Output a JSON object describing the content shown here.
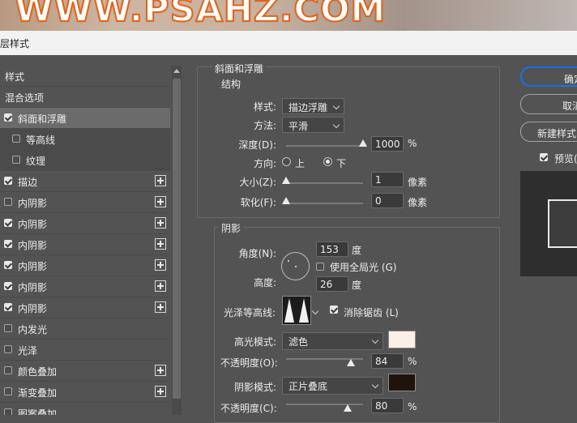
{
  "banner": {
    "text": "WWW.PSAHZ.COM"
  },
  "dialog": {
    "title": "层样式"
  },
  "left_list": [
    {
      "label": "样式",
      "checkbox": null,
      "plus": false,
      "state": "normal"
    },
    {
      "label": "混合选项",
      "checkbox": null,
      "plus": false,
      "state": "normal"
    },
    {
      "label": "斜面和浮雕",
      "checkbox": true,
      "plus": false,
      "state": "selected"
    },
    {
      "label": "等高线",
      "checkbox": false,
      "plus": false,
      "state": "sub"
    },
    {
      "label": "纹理",
      "checkbox": false,
      "plus": false,
      "state": "sub"
    },
    {
      "label": "描边",
      "checkbox": true,
      "plus": true,
      "state": "normal"
    },
    {
      "label": "内阴影",
      "checkbox": false,
      "plus": true,
      "state": "normal"
    },
    {
      "label": "内阴影",
      "checkbox": true,
      "plus": true,
      "state": "normal"
    },
    {
      "label": "内阴影",
      "checkbox": true,
      "plus": true,
      "state": "normal"
    },
    {
      "label": "内阴影",
      "checkbox": true,
      "plus": true,
      "state": "normal"
    },
    {
      "label": "内阴影",
      "checkbox": true,
      "plus": true,
      "state": "normal"
    },
    {
      "label": "内阴影",
      "checkbox": true,
      "plus": true,
      "state": "normal"
    },
    {
      "label": "内发光",
      "checkbox": false,
      "plus": false,
      "state": "normal"
    },
    {
      "label": "光泽",
      "checkbox": false,
      "plus": false,
      "state": "normal"
    },
    {
      "label": "颜色叠加",
      "checkbox": false,
      "plus": true,
      "state": "normal"
    },
    {
      "label": "渐变叠加",
      "checkbox": false,
      "plus": true,
      "state": "normal"
    },
    {
      "label": "图案叠加",
      "checkbox": false,
      "plus": false,
      "state": "normal"
    }
  ],
  "bevel": {
    "section_title": "斜面和浮雕",
    "structure_title": "结构",
    "style_label": "样式:",
    "style_value": "描边浮雕",
    "technique_label": "方法:",
    "technique_value": "平滑",
    "depth_label": "深度(D):",
    "depth_value": "1000",
    "depth_unit": "%",
    "depth_level": 1.0,
    "direction_label": "方向:",
    "dir_up": "上",
    "dir_down": "下",
    "dir_selected": "下",
    "size_label": "大小(Z):",
    "size_value": "1",
    "size_unit": "像素",
    "size_level": 0.0,
    "soften_label": "软化(F):",
    "soften_value": "0",
    "soften_unit": "像素",
    "soften_level": 0.0
  },
  "shading": {
    "title": "阴影",
    "angle_label": "角度(N):",
    "angle_value": "153",
    "angle_unit": "度",
    "global_light_label": "使用全局光 (G)",
    "global_light_checked": false,
    "altitude_label": "高度:",
    "altitude_value": "26",
    "altitude_unit": "度",
    "gloss_label": "光泽等高线:",
    "antialias_label": "消除锯齿 (L)",
    "antialias_checked": true,
    "highlight_mode_label": "高光模式:",
    "highlight_mode_value": "滤色",
    "highlight_color": "#fcf0e6",
    "highlight_opacity_label": "不透明度(O):",
    "highlight_opacity_value": "84",
    "highlight_opacity_unit": "%",
    "highlight_opacity_level": 0.84,
    "shadow_mode_label": "阴影模式:",
    "shadow_mode_value": "正片叠底",
    "shadow_color": "#1f140c",
    "shadow_opacity_label": "不透明度(C):",
    "shadow_opacity_value": "80",
    "shadow_opacity_unit": "%",
    "shadow_opacity_level": 0.8
  },
  "right": {
    "ok_label": "确定",
    "cancel_label": "取消",
    "new_style_label": "新建样式...",
    "preview_label": "预览(V)",
    "preview_checked": true
  },
  "colors": {
    "panel_bg": "#535353",
    "accent": "#1473e6"
  }
}
